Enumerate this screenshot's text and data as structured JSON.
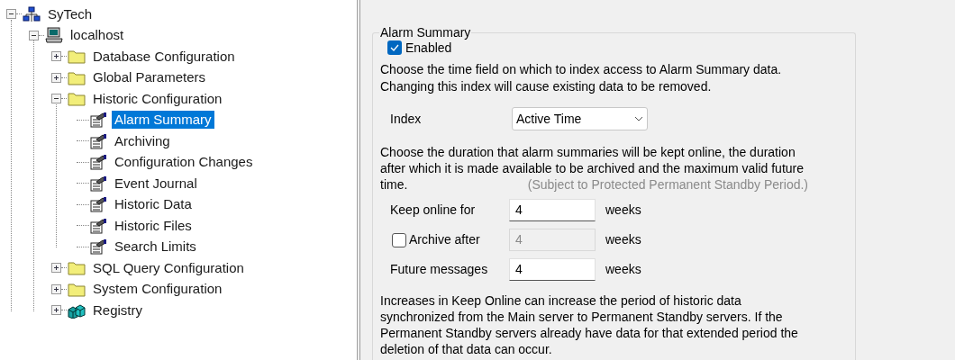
{
  "tree": [
    {
      "label": "SyTech",
      "kind": "network",
      "expanded": true,
      "selected": false,
      "children": [
        {
          "label": "localhost",
          "kind": "computer",
          "expanded": true,
          "selected": false,
          "children": [
            {
              "label": "Database Configuration",
              "kind": "folder",
              "expanded": false,
              "selected": false
            },
            {
              "label": "Global Parameters",
              "kind": "folder",
              "expanded": false,
              "selected": false
            },
            {
              "label": "Historic Configuration",
              "kind": "folder",
              "expanded": true,
              "selected": false,
              "children": [
                {
                  "label": "Alarm Summary",
                  "kind": "page",
                  "selected": true
                },
                {
                  "label": "Archiving",
                  "kind": "page",
                  "selected": false
                },
                {
                  "label": "Configuration Changes",
                  "kind": "page",
                  "selected": false
                },
                {
                  "label": "Event Journal",
                  "kind": "page",
                  "selected": false
                },
                {
                  "label": "Historic Data",
                  "kind": "page",
                  "selected": false
                },
                {
                  "label": "Historic Files",
                  "kind": "page",
                  "selected": false
                },
                {
                  "label": "Search Limits",
                  "kind": "page",
                  "selected": false
                }
              ]
            },
            {
              "label": "SQL Query Configuration",
              "kind": "folder",
              "expanded": false,
              "selected": false
            },
            {
              "label": "System Configuration",
              "kind": "folder",
              "expanded": false,
              "selected": false
            },
            {
              "label": "Registry",
              "kind": "registry",
              "expanded": false,
              "selected": false
            }
          ]
        }
      ]
    }
  ],
  "panel": {
    "group_title": "Alarm Summary",
    "enabled": {
      "label": "Enabled",
      "checked": true
    },
    "index_help": "Choose the time field on which to index access to Alarm Summary data. Changing this index will cause existing data to be removed.",
    "index": {
      "label": "Index",
      "value": "Active Time"
    },
    "duration_help": "Choose the duration that alarm summaries will be kept online, the duration after which it is made available to be archived and the maximum valid future time.",
    "duration_note": "(Subject to Protected Permanent Standby Period.)",
    "durations": [
      {
        "kind": "label",
        "label": "Keep online for",
        "value": "4",
        "disabled": false,
        "unit": "weeks"
      },
      {
        "kind": "checkbox",
        "label": "Archive after",
        "checked": false,
        "value": "4",
        "disabled": true,
        "unit": "weeks"
      },
      {
        "kind": "label",
        "label": "Future messages",
        "value": "4",
        "disabled": false,
        "unit": "weeks"
      }
    ],
    "warning": "Increases in Keep Online can increase the period of historic data synchronized from the Main server to Permanent Standby servers. If the Permanent Standby servers already have data for that extended period the deletion of that data can occur."
  }
}
